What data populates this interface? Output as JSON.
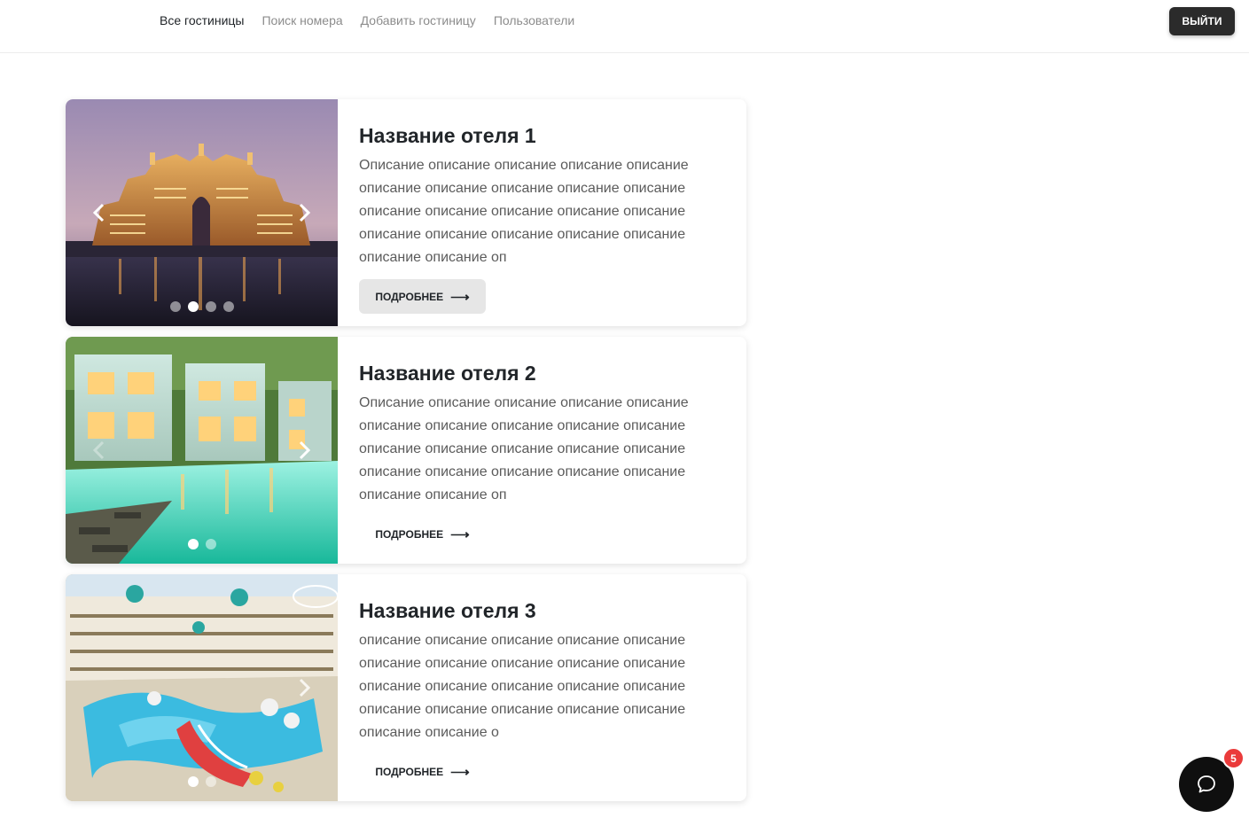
{
  "nav": {
    "items": [
      "Все гостиницы",
      "Поиск номера",
      "Добавить гостиницу",
      "Пользователи"
    ],
    "active_index": 0
  },
  "logout_label": "ВЫЙТИ",
  "hotels": [
    {
      "title": "Название отеля 1",
      "description": "Описание описание описание описание описание описание описание описание описание описание описание описание описание описание описание описание описание описание описание описание описание описание оп",
      "more_label": "ПОДРОБНЕЕ",
      "more_arrow": "⟶",
      "slides": 4,
      "active_slide": 2
    },
    {
      "title": "Название отеля 2",
      "description": "Описание описание описание описание описание описание описание описание описание описание описание описание описание описание описание описание описание описание описание описание описание описание оп",
      "more_label": "ПОДРОБНЕЕ",
      "more_arrow": "⟶",
      "slides": 2,
      "active_slide": 1
    },
    {
      "title": "Название отеля 3",
      "description": "описание описание описание описание описание описание описание описание описание описание описание описание описание описание описание описание описание описание описание описание описание описание о",
      "more_label": "ПОДРОБНЕЕ",
      "more_arrow": "⟶",
      "slides": 2,
      "active_slide": 1
    }
  ],
  "chat": {
    "badge_count": "5",
    "icon": "chat-bubble-icon"
  },
  "colors": {
    "logout_bg": "#2b2b2b",
    "badge": "#ea3b3b",
    "chat_bg": "#0f0f0f"
  }
}
